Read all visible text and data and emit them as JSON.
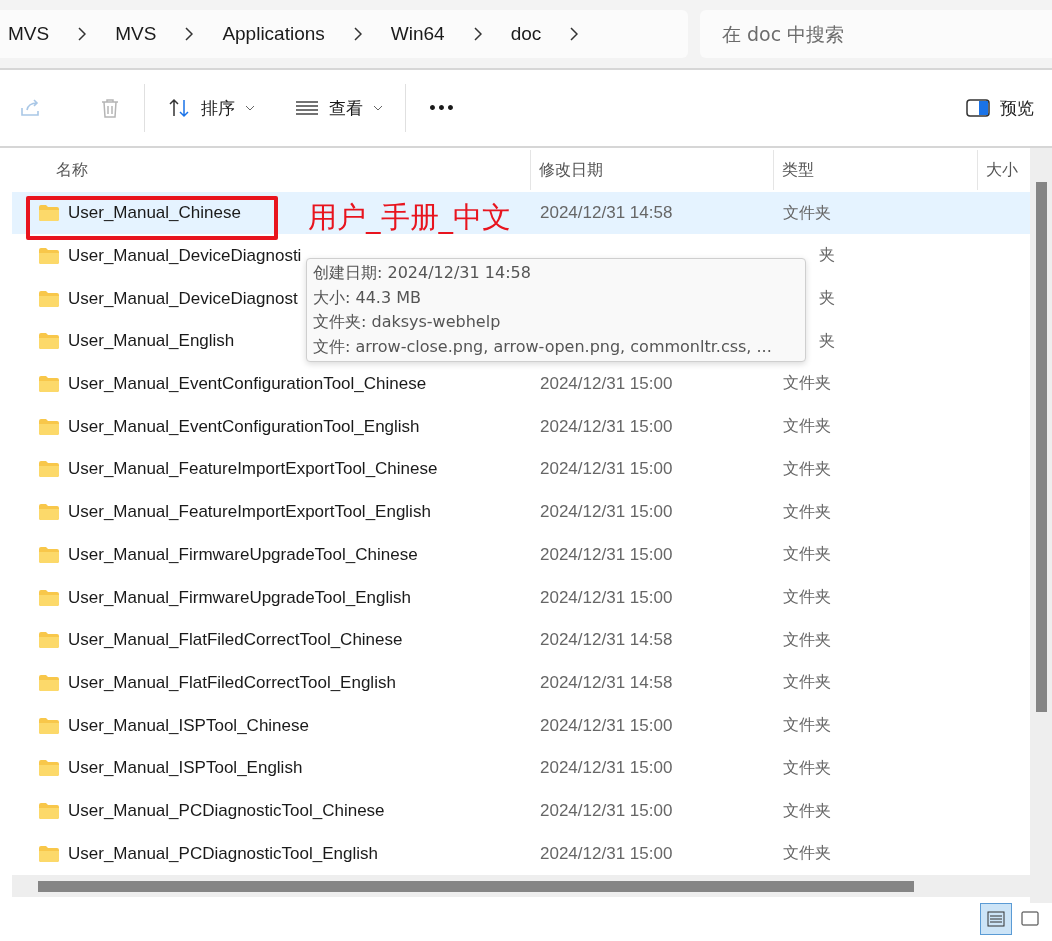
{
  "breadcrumb": [
    "MVS",
    "MVS",
    "Applications",
    "Win64",
    "doc"
  ],
  "search": {
    "placeholder": "在 doc 中搜索"
  },
  "toolbar": {
    "sort": "排序",
    "view": "查看",
    "more": "•••",
    "preview": "预览"
  },
  "columns": [
    "名称",
    "修改日期",
    "类型",
    "大小"
  ],
  "rows": [
    {
      "name": "User_Manual_Chinese",
      "date": "2024/12/31 14:58",
      "type": "文件夹",
      "selected": true
    },
    {
      "name": "User_Manual_DeviceDiagnosti",
      "date": "",
      "type": "夹",
      "selected": false
    },
    {
      "name": "User_Manual_DeviceDiagnost",
      "date": "",
      "type": "夹",
      "selected": false
    },
    {
      "name": "User_Manual_English",
      "date": "",
      "type": "夹",
      "selected": false
    },
    {
      "name": "User_Manual_EventConfigurationTool_Chinese",
      "date": "2024/12/31 15:00",
      "type": "文件夹",
      "selected": false
    },
    {
      "name": "User_Manual_EventConfigurationTool_English",
      "date": "2024/12/31 15:00",
      "type": "文件夹",
      "selected": false
    },
    {
      "name": "User_Manual_FeatureImportExportTool_Chinese",
      "date": "2024/12/31 15:00",
      "type": "文件夹",
      "selected": false
    },
    {
      "name": "User_Manual_FeatureImportExportTool_English",
      "date": "2024/12/31 15:00",
      "type": "文件夹",
      "selected": false
    },
    {
      "name": "User_Manual_FirmwareUpgradeTool_Chinese",
      "date": "2024/12/31 15:00",
      "type": "文件夹",
      "selected": false
    },
    {
      "name": "User_Manual_FirmwareUpgradeTool_English",
      "date": "2024/12/31 15:00",
      "type": "文件夹",
      "selected": false
    },
    {
      "name": "User_Manual_FlatFiledCorrectTool_Chinese",
      "date": "2024/12/31 14:58",
      "type": "文件夹",
      "selected": false
    },
    {
      "name": "User_Manual_FlatFiledCorrectTool_English",
      "date": "2024/12/31 14:58",
      "type": "文件夹",
      "selected": false
    },
    {
      "name": "User_Manual_ISPTool_Chinese",
      "date": "2024/12/31 15:00",
      "type": "文件夹",
      "selected": false
    },
    {
      "name": "User_Manual_ISPTool_English",
      "date": "2024/12/31 15:00",
      "type": "文件夹",
      "selected": false
    },
    {
      "name": "User_Manual_PCDiagnosticTool_Chinese",
      "date": "2024/12/31 15:00",
      "type": "文件夹",
      "selected": false
    },
    {
      "name": "User_Manual_PCDiagnosticTool_English",
      "date": "2024/12/31 15:00",
      "type": "文件夹",
      "selected": false
    }
  ],
  "annotation": "用户_手册_中文",
  "tooltip": [
    "创建日期: 2024/12/31 14:58",
    "大小: 44.3 MB",
    "文件夹: daksys-webhelp",
    "文件: arrow-close.png, arrow-open.png, commonltr.css, ..."
  ],
  "view_buttons": [
    {
      "kind": "details",
      "selected": true
    },
    {
      "kind": "tiles",
      "selected": false
    }
  ]
}
